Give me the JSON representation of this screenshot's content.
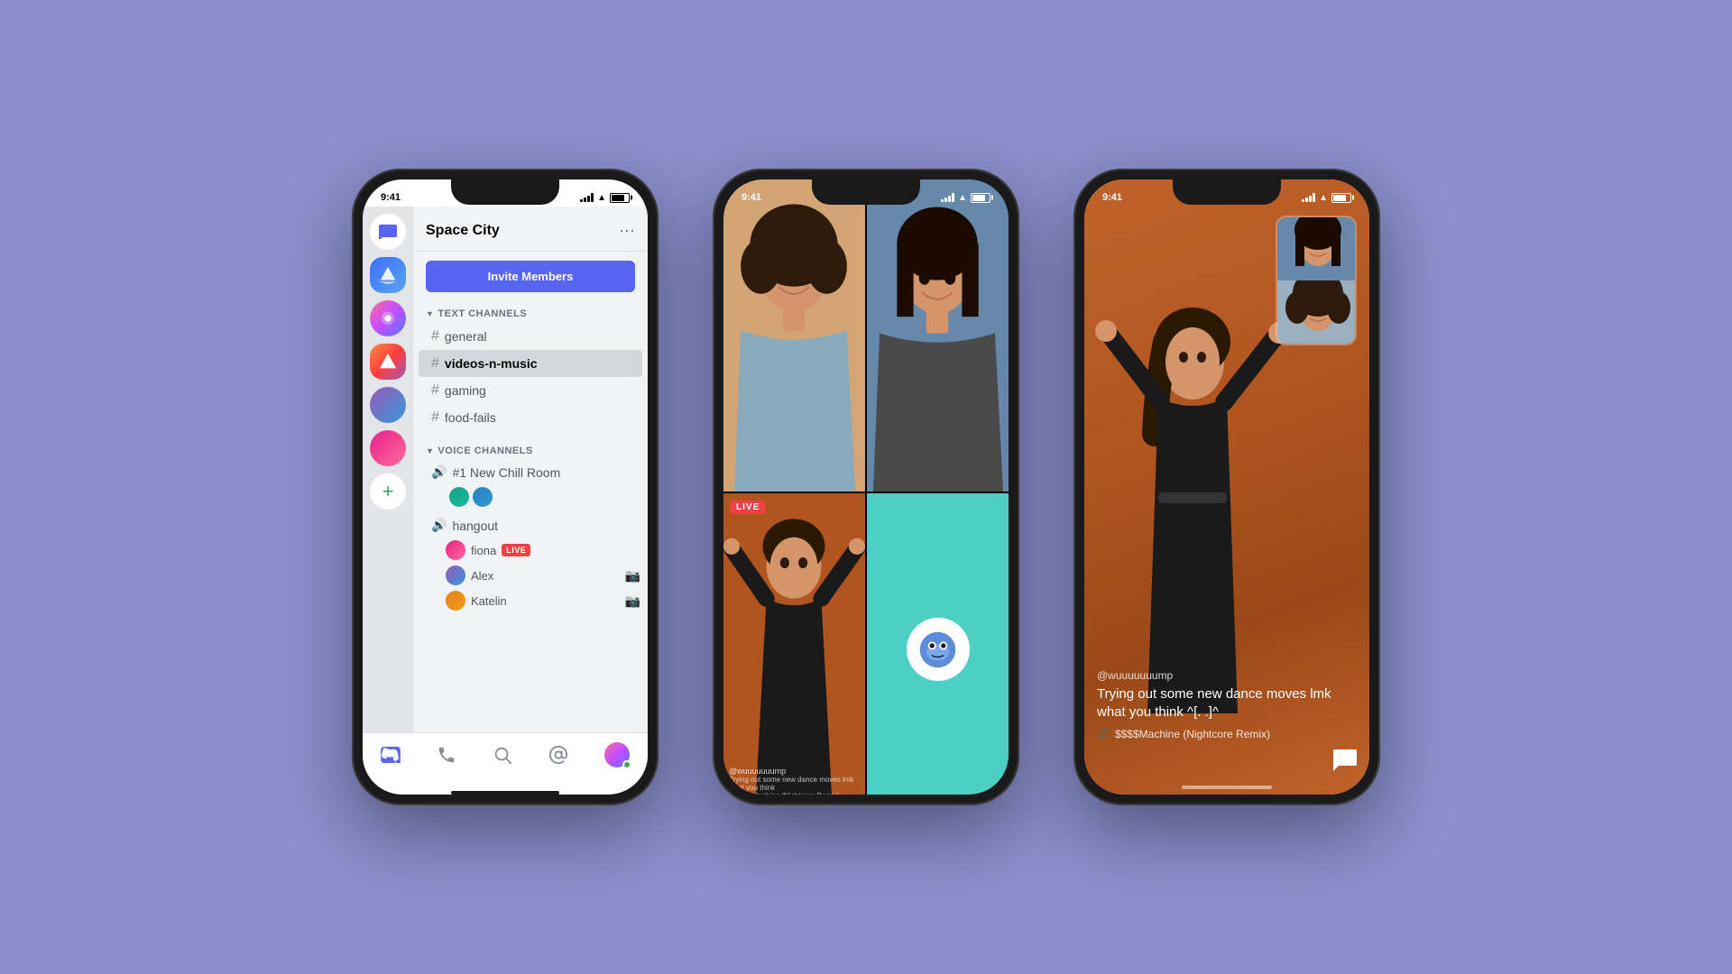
{
  "background_color": "#8b8fcc",
  "phone1": {
    "status_time": "9:41",
    "server_name": "Space City",
    "invite_btn": "Invite Members",
    "text_channels_label": "TEXT CHANNELS",
    "channels": [
      {
        "name": "general",
        "active": false
      },
      {
        "name": "videos-n-music",
        "active": true
      },
      {
        "name": "gaming",
        "active": false
      },
      {
        "name": "food-fails",
        "active": false
      }
    ],
    "voice_channels_label": "VOICE CHANNELS",
    "voice_channels": [
      {
        "name": "#1 New Chill Room",
        "members": []
      },
      {
        "name": "hangout",
        "members": [
          {
            "name": "fiona",
            "live": true
          },
          {
            "name": "Alex",
            "live": false
          },
          {
            "name": "Katelin",
            "live": false
          }
        ]
      }
    ],
    "nav_items": [
      "discord",
      "phone",
      "search",
      "at",
      "person"
    ]
  },
  "phone2": {
    "status_time": "9:41",
    "live_badge": "LIVE",
    "bottom_text": {
      "username": "@wuuuuuuump",
      "description": "Trying out some new dance moves lmk what you think"
    },
    "song": "$$$$Machine (Nightcore Remix)"
  },
  "phone3": {
    "status_time": "9:41",
    "username": "@wuuuuuuump",
    "description": "Trying out some new dance moves lmk what you think ^[. .]^",
    "song": "$$$$Machine (Nightcore Remix)"
  }
}
